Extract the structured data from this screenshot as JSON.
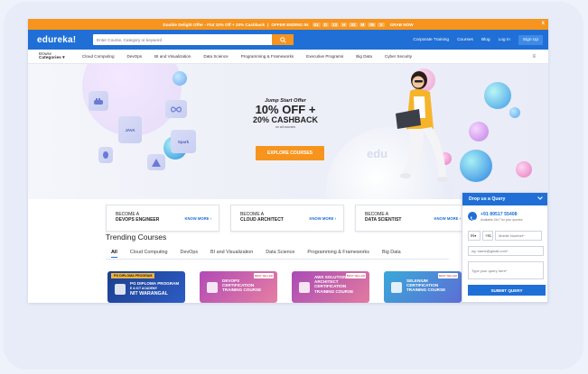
{
  "promo": {
    "text": "Double Delight Offer - Flat 10% Off + 20% Cashback",
    "separator": "|",
    "offer_ending": "OFFER ENDING IN:",
    "countdown": [
      "01",
      "D",
      "13",
      "H",
      "32",
      "M",
      "05",
      "S"
    ],
    "grab": "GRAB NOW",
    "close": "x"
  },
  "header": {
    "logo": "edureka!",
    "search_placeholder": "Enter Course, Category or keyword",
    "links": [
      "Corporate Training",
      "Courses",
      "Blog",
      "Log In"
    ],
    "signup": "Sign Up"
  },
  "catnav": {
    "browse_small": "Browse",
    "browse_big": "Categories",
    "items": [
      "Cloud Computing",
      "DevOps",
      "BI and Visualization",
      "Data Science",
      "Programming & Frameworks",
      "Executive Programs",
      "Big Data",
      "Cyber Security"
    ]
  },
  "hero": {
    "offer_top": "Jump Start Offer",
    "offer_line1": "10% OFF +",
    "offer_line2": "20% CASHBACK",
    "offer_small": "on all courses",
    "explore": "EXPLORE COURSES",
    "tiles": [
      "JAVA",
      "Spark"
    ],
    "watermark": "edu"
  },
  "cards": [
    {
      "line1": "BECOME A",
      "line2": "DEVOPS ENGINEER",
      "link": "KNOW MORE"
    },
    {
      "line1": "BECOME A",
      "line2": "CLOUD ARCHITECT",
      "link": "KNOW MORE"
    },
    {
      "line1": "BECOME A",
      "line2": "DATA SCIENTIST",
      "link": "KNOW MORE"
    }
  ],
  "trending": {
    "title": "Trending Courses",
    "tabs": [
      "All",
      "Cloud Computing",
      "DevOps",
      "BI and Visualization",
      "Data Science",
      "Programming & Frameworks",
      "Big Data"
    ],
    "courses": [
      {
        "line1": "PG DIPLOMA PROGRAM",
        "line2": "PG DIPLOMA PROGRAM",
        "line3": "E & ICT ACADEMY",
        "line4": "NIT WARANGAL",
        "best": ""
      },
      {
        "line1": "DEVOPS",
        "line2": "CERTIFICATION",
        "line3": "TRAINING COURSE",
        "line4": "",
        "best": "BEST SELLER"
      },
      {
        "line1": "AWS SOLUTION",
        "line2": "ARCHITECT",
        "line3": "CERTIFICATION",
        "line4": "TRAINING COURSE",
        "best": "BEST SELLER"
      },
      {
        "line1": "SELENIUM",
        "line2": "CERTIFICATION",
        "line3": "TRAINING COURSE",
        "line4": "",
        "best": "BEST SELLER"
      }
    ]
  },
  "drop_query": {
    "title": "Drop us a Query",
    "phone": "+91 89517 55408",
    "availability": "Available 24x7 for your queries",
    "country": "IN",
    "code": "+91",
    "mobile_placeholder": "Mobile Number*",
    "email_placeholder": "eg: name@gmail.com*",
    "query_placeholder": "Type your query here*",
    "submit": "SUBMIT QUERY"
  },
  "colors": {
    "brand_blue": "#1f6fd6",
    "accent_orange": "#f7941d"
  }
}
